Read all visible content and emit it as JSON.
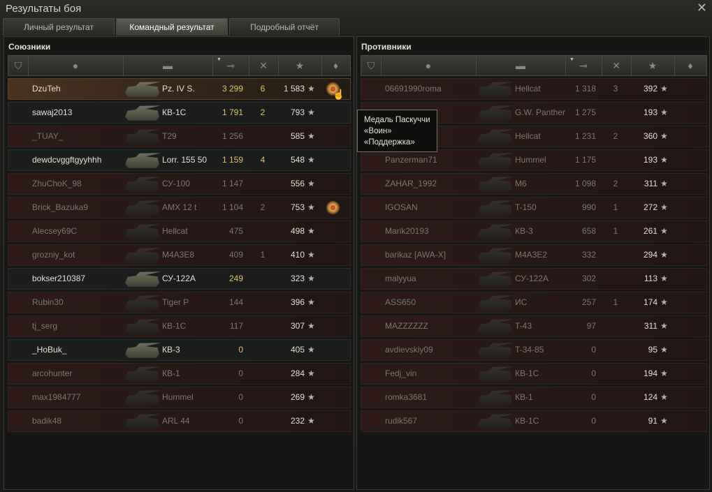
{
  "window": {
    "title": "Результаты боя",
    "close_icon": "close-icon"
  },
  "tabs": [
    {
      "label": "Личный результат"
    },
    {
      "label": "Командный результат",
      "active": true
    },
    {
      "label": "Подробный отчёт"
    }
  ],
  "allies": {
    "title": "Союзники",
    "rows": [
      {
        "name": "DzuTeh",
        "tank": "Pz. IV S.",
        "damage": "3 299",
        "kills": "6",
        "xp": "1 583",
        "medal": true,
        "state": "self"
      },
      {
        "name": "sawaj2013",
        "tank": "КВ-1С",
        "damage": "1 791",
        "kills": "2",
        "xp": "793",
        "state": "alive"
      },
      {
        "name": "_TUAY_",
        "tank": "T29",
        "damage": "1 256",
        "kills": "",
        "xp": "585",
        "state": "dead"
      },
      {
        "name": "dewdcvggftgyyhhh",
        "tank": "Lorr. 155 50",
        "damage": "1 159",
        "kills": "4",
        "xp": "548",
        "state": "alive"
      },
      {
        "name": "ZhuChoK_98",
        "tank": "СУ-100",
        "damage": "1 147",
        "kills": "",
        "xp": "556",
        "state": "dead"
      },
      {
        "name": "Brick_Bazuka9",
        "tank": "AMX 12 t",
        "damage": "1 104",
        "kills": "2",
        "xp": "753",
        "medal": true,
        "state": "dead"
      },
      {
        "name": "Alecsey69C",
        "tank": "Hellcat",
        "damage": "475",
        "kills": "",
        "xp": "498",
        "state": "dead"
      },
      {
        "name": "grozniy_kot",
        "tank": "M4A3E8",
        "damage": "409",
        "kills": "1",
        "xp": "410",
        "state": "dead"
      },
      {
        "name": "bokser210387",
        "tank": "СУ-122А",
        "damage": "249",
        "kills": "",
        "xp": "323",
        "state": "alive"
      },
      {
        "name": "Rubin30",
        "tank": "Tiger P",
        "damage": "144",
        "kills": "",
        "xp": "396",
        "state": "dead"
      },
      {
        "name": "tj_serg",
        "tank": "КВ-1С",
        "damage": "117",
        "kills": "",
        "xp": "307",
        "state": "dead"
      },
      {
        "name": "_HoBuk_",
        "tank": "КВ-3",
        "damage": "0",
        "kills": "",
        "xp": "405",
        "state": "alive"
      },
      {
        "name": "arcohunter",
        "tank": "КВ-1",
        "damage": "0",
        "kills": "",
        "xp": "284",
        "state": "dead"
      },
      {
        "name": "max1984777",
        "tank": "Hummel",
        "damage": "0",
        "kills": "",
        "xp": "269",
        "state": "dead"
      },
      {
        "name": "badik48",
        "tank": "ARL 44",
        "damage": "0",
        "kills": "",
        "xp": "232",
        "state": "dead"
      }
    ]
  },
  "enemies": {
    "title": "Противники",
    "rows": [
      {
        "name": "06691990roma",
        "tank": "Hellcat",
        "damage": "1 318",
        "kills": "3",
        "xp": "392",
        "state": "dead"
      },
      {
        "name": "",
        "tank": "G.W. Panther",
        "damage": "1 275",
        "kills": "",
        "xp": "193",
        "state": "dead"
      },
      {
        "name": "",
        "tank": "Hellcat",
        "damage": "1 231",
        "kills": "2",
        "xp": "360",
        "state": "dead"
      },
      {
        "name": "Panzerman71",
        "tank": "Hummel",
        "damage": "1 175",
        "kills": "",
        "xp": "193",
        "state": "dead"
      },
      {
        "name": "ZAHAR_1992",
        "tank": "M6",
        "damage": "1 098",
        "kills": "2",
        "xp": "311",
        "state": "dead"
      },
      {
        "name": "IGOSAN",
        "tank": "T-150",
        "damage": "990",
        "kills": "1",
        "xp": "272",
        "state": "dead"
      },
      {
        "name": "Marik20193",
        "tank": "КВ-3",
        "damage": "658",
        "kills": "1",
        "xp": "261",
        "state": "dead"
      },
      {
        "name": "barikaz [AWA-X]",
        "tank": "M4A3E2",
        "damage": "332",
        "kills": "",
        "xp": "294",
        "state": "dead"
      },
      {
        "name": "malyyua",
        "tank": "СУ-122А",
        "damage": "302",
        "kills": "",
        "xp": "113",
        "state": "dead"
      },
      {
        "name": "ASS650",
        "tank": "ИС",
        "damage": "257",
        "kills": "1",
        "xp": "174",
        "state": "dead"
      },
      {
        "name": "MAZZZZZZ",
        "tank": "T-43",
        "damage": "97",
        "kills": "",
        "xp": "311",
        "state": "dead"
      },
      {
        "name": "avdievskiy09",
        "tank": "T-34-85",
        "damage": "0",
        "kills": "",
        "xp": "95",
        "state": "dead"
      },
      {
        "name": "Fedj_vin",
        "tank": "КВ-1С",
        "damage": "0",
        "kills": "",
        "xp": "194",
        "state": "dead"
      },
      {
        "name": "romka3681",
        "tank": "КВ-1",
        "damage": "0",
        "kills": "",
        "xp": "124",
        "state": "dead"
      },
      {
        "name": "rudik567",
        "tank": "КВ-1С",
        "damage": "0",
        "kills": "",
        "xp": "91",
        "state": "dead"
      }
    ]
  },
  "tooltip": {
    "lines": [
      "Медаль Паскуччи",
      "«Воин»",
      "«Поддержка»"
    ]
  },
  "columns": [
    {
      "icon": "squad-icon",
      "glyph": "⛉"
    },
    {
      "icon": "player-icon",
      "glyph": "●"
    },
    {
      "icon": "tank-icon",
      "glyph": "▬"
    },
    {
      "icon": "damage-icon",
      "glyph": "⊸",
      "sorted": true
    },
    {
      "icon": "frags-icon",
      "glyph": "✕"
    },
    {
      "icon": "xp-icon",
      "glyph": "★"
    },
    {
      "icon": "medal-icon",
      "glyph": "♦"
    }
  ],
  "colors": {
    "highlight": "#e1c36a",
    "dead_text": "#7d7770",
    "alive_text": "#e6e0d2"
  }
}
